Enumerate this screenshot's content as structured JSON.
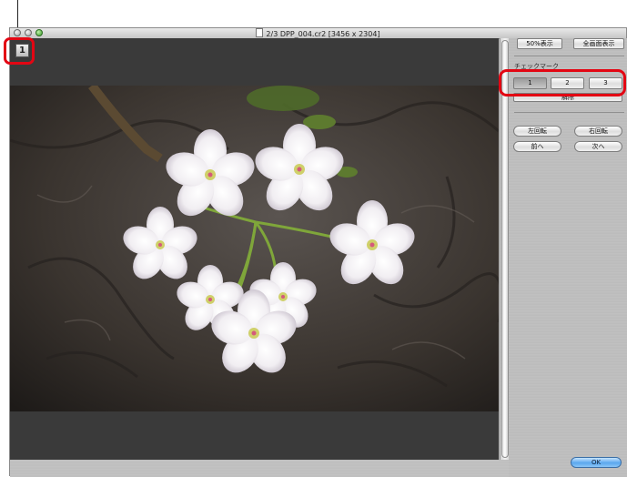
{
  "window": {
    "title": "2/3 DPP_004.cr2 [3456 x 2304]"
  },
  "viewer": {
    "check_mark_indicator": "1"
  },
  "panel": {
    "btn_50": "50%表示",
    "btn_full": "全画面表示",
    "check_label": "チェックマーク",
    "check_buttons": [
      "1",
      "2",
      "3"
    ],
    "clear_label": "解除",
    "rotate_left": "左回転",
    "rotate_right": "右回転",
    "prev": "前へ",
    "next": "次へ",
    "ok": "OK"
  },
  "colors": {
    "highlight": "#e30613",
    "viewer_bg": "#3a3a3a"
  }
}
